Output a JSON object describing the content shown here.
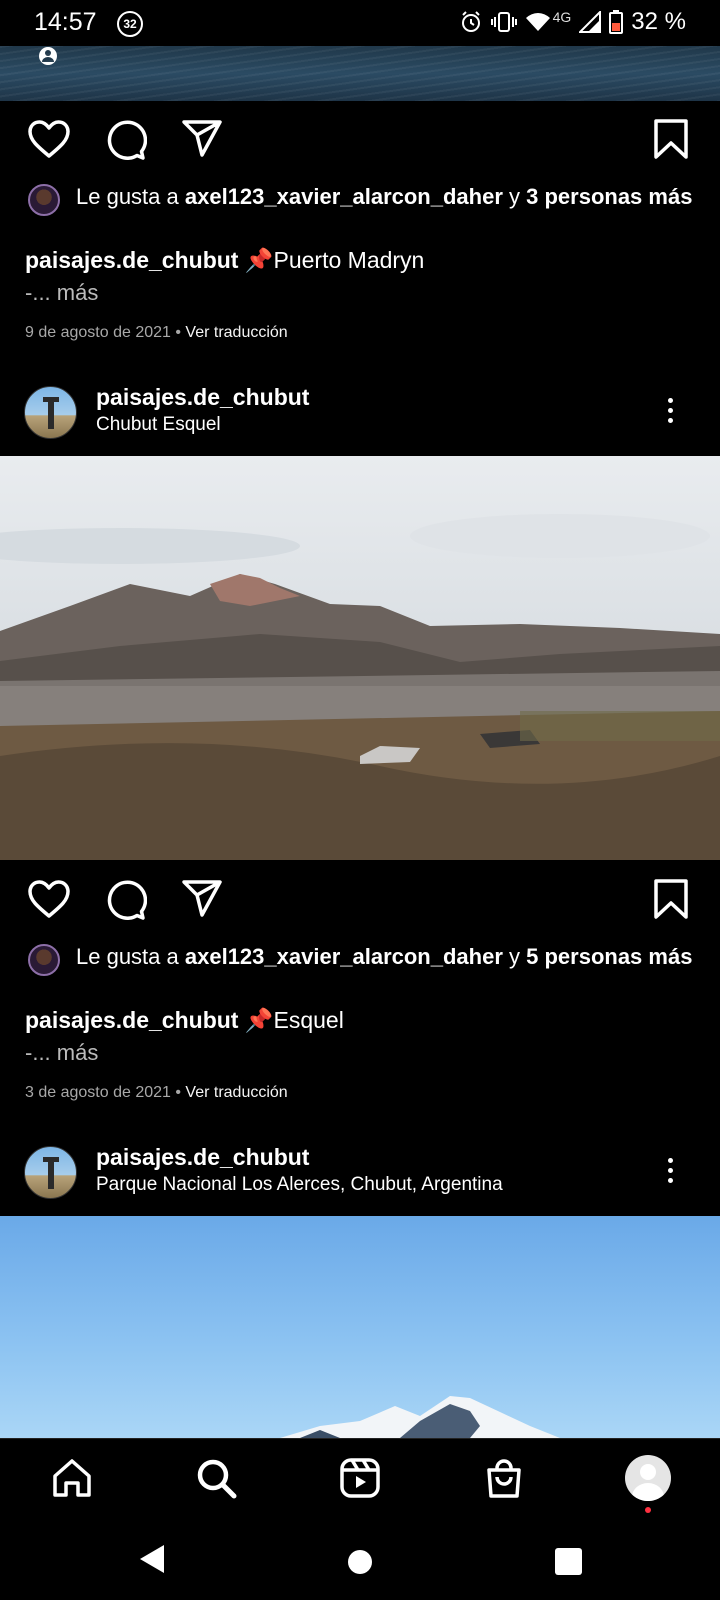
{
  "status_bar": {
    "time": "14:57",
    "notification_count": "32",
    "network": "4G",
    "battery": "32 %"
  },
  "posts": [
    {
      "likes_prefix": "Le gusta a ",
      "liker": "axel123_xavier_alarcon_daher",
      "likes_connector": " y ",
      "likes_others": "3 personas más",
      "caption_user": "paisajes.de_chubut",
      "caption_pin": "📌",
      "caption_text": "Puerto Madryn",
      "more": "-... más",
      "date": "9 de agosto de 2021",
      "separator": " • ",
      "translate": "Ver traducción"
    },
    {
      "username": "paisajes.de_chubut",
      "location": "Chubut Esquel",
      "likes_prefix": "Le gusta a ",
      "liker": "axel123_xavier_alarcon_daher",
      "likes_connector": " y ",
      "likes_others": "5 personas más",
      "caption_user": "paisajes.de_chubut",
      "caption_pin": "📌",
      "caption_text": "Esquel",
      "more": "-... más",
      "date": "3 de agosto de 2021",
      "separator": " • ",
      "translate": "Ver traducción"
    },
    {
      "username": "paisajes.de_chubut",
      "location": "Parque Nacional Los Alerces, Chubut, Argentina"
    }
  ],
  "icons": {
    "like": "heart-icon",
    "comment": "comment-bubble-icon",
    "share": "paper-plane-icon",
    "save": "bookmark-icon",
    "menu": "more-vertical-icon",
    "nav": [
      "home-icon",
      "search-icon",
      "reels-icon",
      "shop-bag-icon",
      "profile-avatar"
    ]
  },
  "colors": {
    "background": "#000000",
    "text": "#ffffff",
    "muted": "#a8a8a8",
    "notification_dot": "#ff3040"
  }
}
